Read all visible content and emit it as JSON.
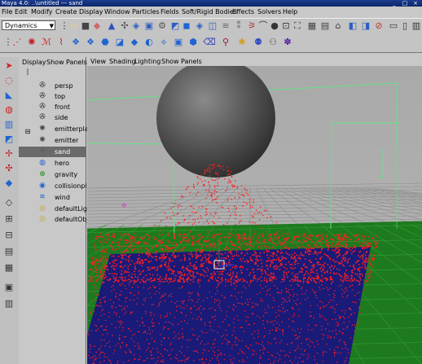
{
  "window": {
    "title": "Maya 4.0: ..\\untitled  ---  sand"
  },
  "menubar": [
    "File",
    "Edit",
    "Modify",
    "Create",
    "Display",
    "Window",
    "Particles",
    "Fields",
    "Soft/Rigid Bodies",
    "Effects",
    "Solvers",
    "Help"
  ],
  "shelf": {
    "module_select": "Dynamics"
  },
  "outliner": {
    "menu": [
      "Display",
      "Show",
      "Panels"
    ],
    "items": [
      {
        "label": "persp",
        "icon": "camera-icon",
        "selected": false
      },
      {
        "label": "top",
        "icon": "camera-icon",
        "selected": false
      },
      {
        "label": "front",
        "icon": "camera-icon",
        "selected": false
      },
      {
        "label": "side",
        "icon": "camera-icon",
        "selected": false
      },
      {
        "label": "emitterplane",
        "icon": "emitter-icon",
        "selected": false
      },
      {
        "label": "emitter",
        "icon": "emitter-icon",
        "selected": false
      },
      {
        "label": "sand",
        "icon": "particle-icon",
        "selected": true
      },
      {
        "label": "hero",
        "icon": "mesh-icon",
        "selected": false
      },
      {
        "label": "gravity",
        "icon": "gravity-icon",
        "selected": false
      },
      {
        "label": "collisionplane",
        "icon": "collision-icon",
        "selected": false
      },
      {
        "label": "wind",
        "icon": "wind-icon",
        "selected": false
      },
      {
        "label": "defaultLightSet",
        "icon": "set-icon",
        "selected": false
      },
      {
        "label": "defaultObjectSet",
        "icon": "set-icon",
        "selected": false
      }
    ]
  },
  "viewport": {
    "menu": [
      "View",
      "Shading",
      "Lighting",
      "Show",
      "Panels"
    ]
  },
  "colors": {
    "particles": "#ff2020",
    "ground": "#1e7a1e",
    "sand_bed": "#1a1a78",
    "sphere": "#555555",
    "field_box": "#66e08a"
  }
}
